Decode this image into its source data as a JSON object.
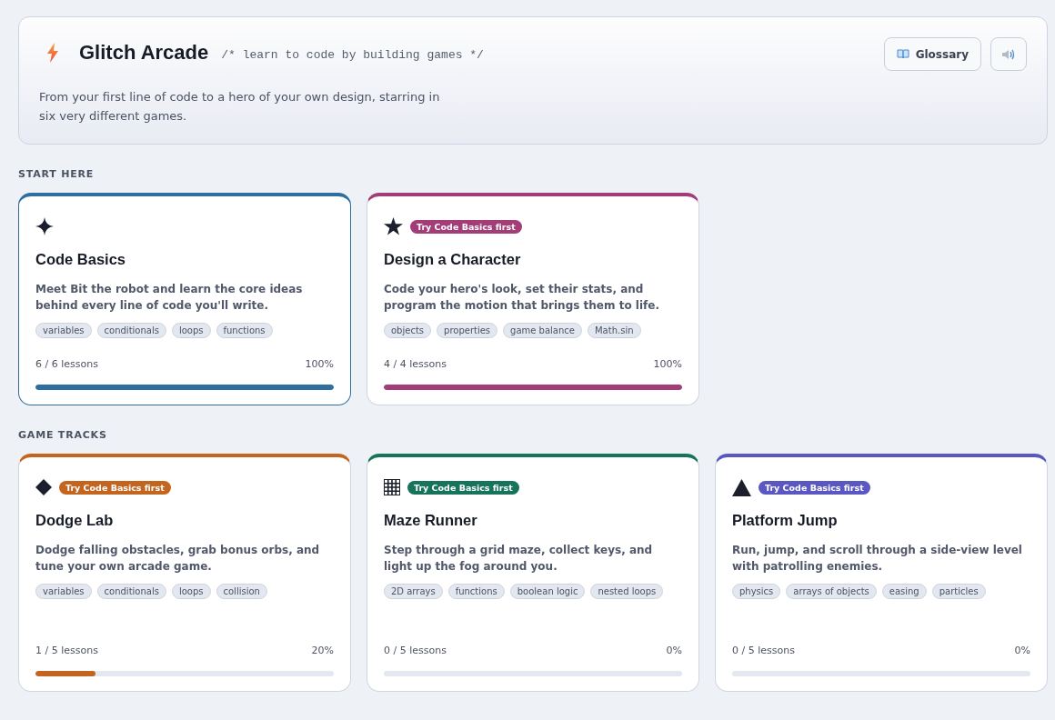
{
  "header": {
    "title": "Glitch Arcade",
    "tagline": "/* learn to code by building games */",
    "intro": "From your first line of code to a hero of your own design, starring in six very different games.",
    "glossary_button": "Glossary"
  },
  "sections": [
    {
      "heading": "START HERE",
      "cards": [
        {
          "kind": "sparkle",
          "color": "#2f6f9f",
          "selected": true,
          "title": "Code Basics",
          "description": "Meet Bit the robot and learn the core ideas behind every line of code you'll write.",
          "tags": [
            "variables",
            "conditionals",
            "loops",
            "functions"
          ],
          "lessons": "6 / 6 lessons",
          "percent": "100%",
          "level": 1
        },
        {
          "kind": "star",
          "color": "#a23d78",
          "selected": false,
          "badge": "Try Code Basics first",
          "title": "Design a Character",
          "description": "Code your hero's look, set their stats, and program the motion that brings them to life.",
          "tags": [
            "objects",
            "properties",
            "game balance",
            "Math.sin"
          ],
          "lessons": "4 / 4 lessons",
          "percent": "100%",
          "level": 1
        }
      ]
    },
    {
      "heading": "GAME TRACKS",
      "cards": [
        {
          "kind": "diamond",
          "color": "#c4651f",
          "selected": false,
          "badge": "Try Code Basics first",
          "title": "Dodge Lab",
          "description": "Dodge falling obstacles, grab bonus orbs, and tune your own arcade game.",
          "tags": [
            "variables",
            "conditionals",
            "loops",
            "collision"
          ],
          "lessons": "1 / 5 lessons",
          "percent": "20%",
          "level": 0.2
        },
        {
          "kind": "grid",
          "color": "#17745a",
          "selected": false,
          "badge": "Try Code Basics first",
          "title": "Maze Runner",
          "description": "Step through a grid maze, collect keys, and light up the fog around you.",
          "tags": [
            "2D arrays",
            "functions",
            "boolean logic",
            "nested loops"
          ],
          "lessons": "0 / 5 lessons",
          "percent": "0%",
          "level": 0
        },
        {
          "kind": "triangle",
          "color": "#5a57c2",
          "selected": false,
          "badge": "Try Code Basics first",
          "title": "Platform Jump",
          "description": "Run, jump, and scroll through a side-view level with patrolling enemies.",
          "tags": [
            "physics",
            "arrays of objects",
            "easing",
            "particles"
          ],
          "lessons": "0 / 5 lessons",
          "percent": "0%",
          "level": 0
        }
      ]
    }
  ]
}
